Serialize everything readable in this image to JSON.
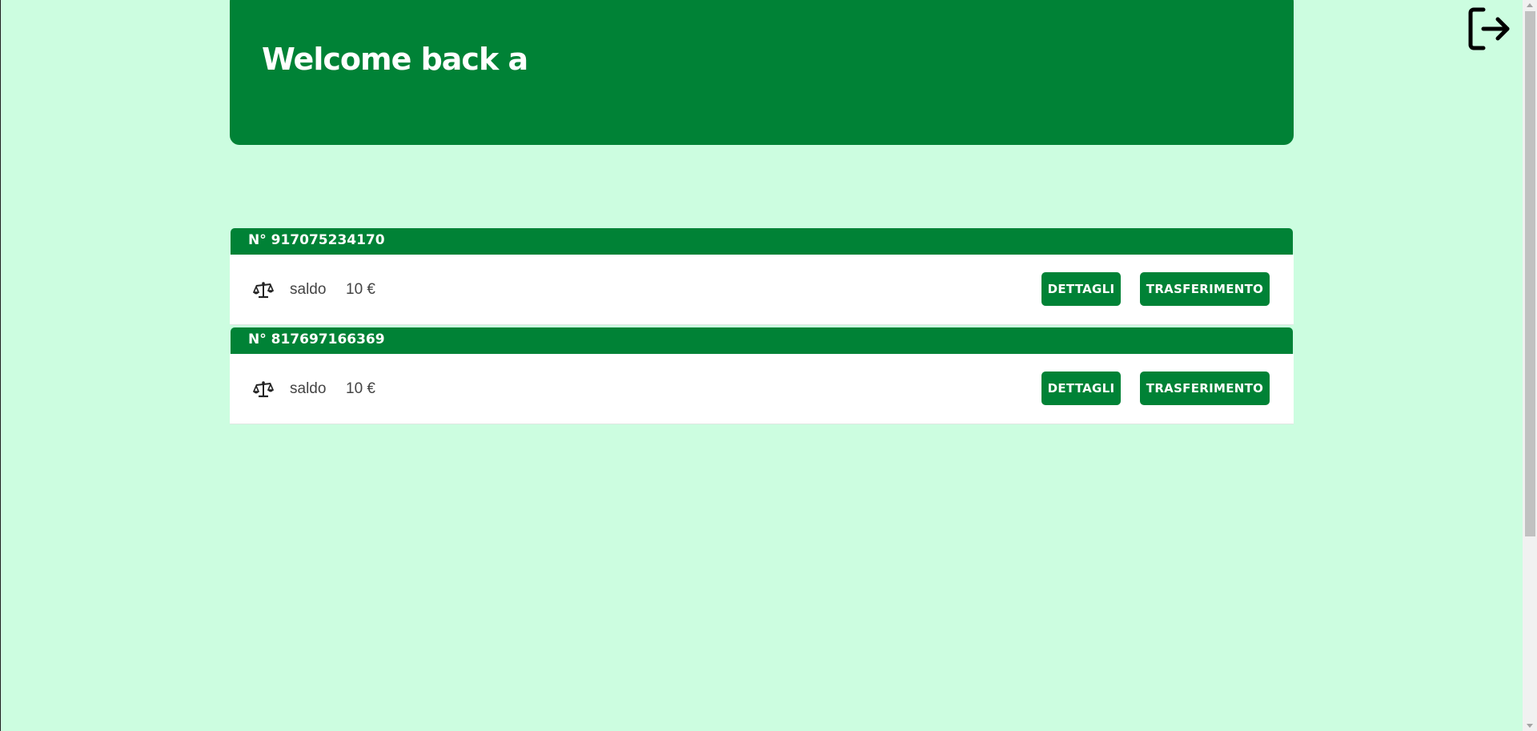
{
  "header": {
    "welcome": "Welcome back a"
  },
  "actions": {
    "logout_icon": "logout-icon"
  },
  "accounts": [
    {
      "number": "N° 917075234170",
      "balance_label": "saldo",
      "balance_value": "10 €",
      "details_label": "DETTAGLI",
      "transfer_label": "TRASFERIMENTO"
    },
    {
      "number": "N° 817697166369",
      "balance_label": "saldo",
      "balance_value": "10 €",
      "details_label": "DETTAGLI",
      "transfer_label": "TRASFERIMENTO"
    }
  ],
  "theme": {
    "background": "#ccfde0",
    "primary": "#008236",
    "card": "#ffffff"
  }
}
